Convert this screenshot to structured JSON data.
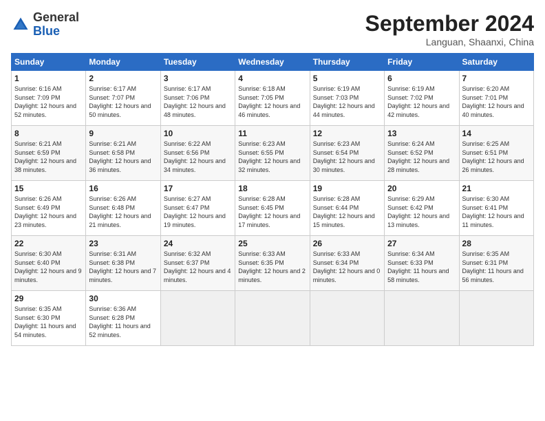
{
  "header": {
    "logo_general": "General",
    "logo_blue": "Blue",
    "month_title": "September 2024",
    "location": "Languan, Shaanxi, China"
  },
  "days_of_week": [
    "Sunday",
    "Monday",
    "Tuesday",
    "Wednesday",
    "Thursday",
    "Friday",
    "Saturday"
  ],
  "weeks": [
    [
      {
        "day": "1",
        "sunrise": "6:16 AM",
        "sunset": "7:09 PM",
        "daylight": "12 hours and 52 minutes."
      },
      {
        "day": "2",
        "sunrise": "6:17 AM",
        "sunset": "7:07 PM",
        "daylight": "12 hours and 50 minutes."
      },
      {
        "day": "3",
        "sunrise": "6:17 AM",
        "sunset": "7:06 PM",
        "daylight": "12 hours and 48 minutes."
      },
      {
        "day": "4",
        "sunrise": "6:18 AM",
        "sunset": "7:05 PM",
        "daylight": "12 hours and 46 minutes."
      },
      {
        "day": "5",
        "sunrise": "6:19 AM",
        "sunset": "7:03 PM",
        "daylight": "12 hours and 44 minutes."
      },
      {
        "day": "6",
        "sunrise": "6:19 AM",
        "sunset": "7:02 PM",
        "daylight": "12 hours and 42 minutes."
      },
      {
        "day": "7",
        "sunrise": "6:20 AM",
        "sunset": "7:01 PM",
        "daylight": "12 hours and 40 minutes."
      }
    ],
    [
      {
        "day": "8",
        "sunrise": "6:21 AM",
        "sunset": "6:59 PM",
        "daylight": "12 hours and 38 minutes."
      },
      {
        "day": "9",
        "sunrise": "6:21 AM",
        "sunset": "6:58 PM",
        "daylight": "12 hours and 36 minutes."
      },
      {
        "day": "10",
        "sunrise": "6:22 AM",
        "sunset": "6:56 PM",
        "daylight": "12 hours and 34 minutes."
      },
      {
        "day": "11",
        "sunrise": "6:23 AM",
        "sunset": "6:55 PM",
        "daylight": "12 hours and 32 minutes."
      },
      {
        "day": "12",
        "sunrise": "6:23 AM",
        "sunset": "6:54 PM",
        "daylight": "12 hours and 30 minutes."
      },
      {
        "day": "13",
        "sunrise": "6:24 AM",
        "sunset": "6:52 PM",
        "daylight": "12 hours and 28 minutes."
      },
      {
        "day": "14",
        "sunrise": "6:25 AM",
        "sunset": "6:51 PM",
        "daylight": "12 hours and 26 minutes."
      }
    ],
    [
      {
        "day": "15",
        "sunrise": "6:26 AM",
        "sunset": "6:49 PM",
        "daylight": "12 hours and 23 minutes."
      },
      {
        "day": "16",
        "sunrise": "6:26 AM",
        "sunset": "6:48 PM",
        "daylight": "12 hours and 21 minutes."
      },
      {
        "day": "17",
        "sunrise": "6:27 AM",
        "sunset": "6:47 PM",
        "daylight": "12 hours and 19 minutes."
      },
      {
        "day": "18",
        "sunrise": "6:28 AM",
        "sunset": "6:45 PM",
        "daylight": "12 hours and 17 minutes."
      },
      {
        "day": "19",
        "sunrise": "6:28 AM",
        "sunset": "6:44 PM",
        "daylight": "12 hours and 15 minutes."
      },
      {
        "day": "20",
        "sunrise": "6:29 AM",
        "sunset": "6:42 PM",
        "daylight": "12 hours and 13 minutes."
      },
      {
        "day": "21",
        "sunrise": "6:30 AM",
        "sunset": "6:41 PM",
        "daylight": "12 hours and 11 minutes."
      }
    ],
    [
      {
        "day": "22",
        "sunrise": "6:30 AM",
        "sunset": "6:40 PM",
        "daylight": "12 hours and 9 minutes."
      },
      {
        "day": "23",
        "sunrise": "6:31 AM",
        "sunset": "6:38 PM",
        "daylight": "12 hours and 7 minutes."
      },
      {
        "day": "24",
        "sunrise": "6:32 AM",
        "sunset": "6:37 PM",
        "daylight": "12 hours and 4 minutes."
      },
      {
        "day": "25",
        "sunrise": "6:33 AM",
        "sunset": "6:35 PM",
        "daylight": "12 hours and 2 minutes."
      },
      {
        "day": "26",
        "sunrise": "6:33 AM",
        "sunset": "6:34 PM",
        "daylight": "12 hours and 0 minutes."
      },
      {
        "day": "27",
        "sunrise": "6:34 AM",
        "sunset": "6:33 PM",
        "daylight": "11 hours and 58 minutes."
      },
      {
        "day": "28",
        "sunrise": "6:35 AM",
        "sunset": "6:31 PM",
        "daylight": "11 hours and 56 minutes."
      }
    ],
    [
      {
        "day": "29",
        "sunrise": "6:35 AM",
        "sunset": "6:30 PM",
        "daylight": "11 hours and 54 minutes."
      },
      {
        "day": "30",
        "sunrise": "6:36 AM",
        "sunset": "6:28 PM",
        "daylight": "11 hours and 52 minutes."
      },
      null,
      null,
      null,
      null,
      null
    ]
  ]
}
